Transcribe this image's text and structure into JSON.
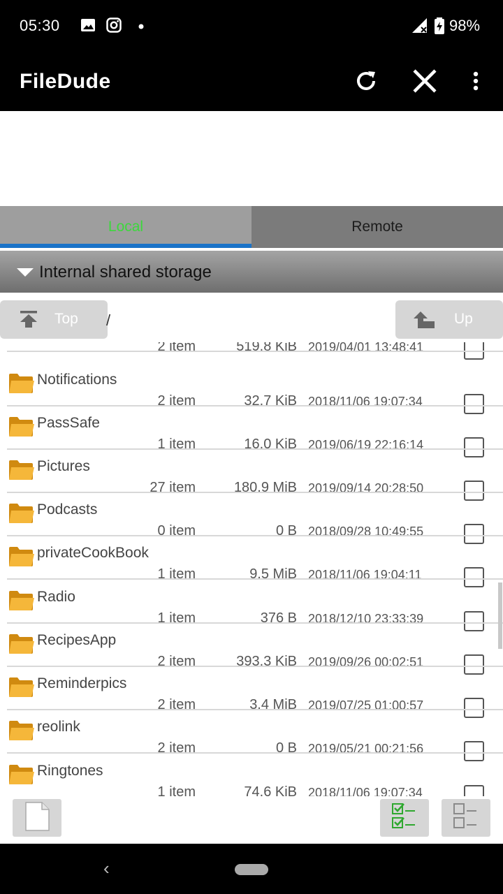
{
  "status_bar": {
    "time": "05:30",
    "battery": "98%",
    "icons": [
      "image-icon",
      "instagram-icon",
      "notification-dot-icon",
      "signal-icon",
      "battery-charging-icon"
    ]
  },
  "app_bar": {
    "title": "FileDude",
    "actions": [
      "refresh-icon",
      "close-icon",
      "more-vert-icon"
    ]
  },
  "tabs": {
    "local": "Local",
    "remote": "Remote",
    "active": "Local"
  },
  "storage": {
    "label": "Internal shared storage"
  },
  "path": {
    "top_label": "Top",
    "up_label": "Up",
    "current": "/"
  },
  "rows": [
    {
      "name": "",
      "count": "2 item",
      "size": "519.8 KiB",
      "date": "2019/04/01 13:48:41"
    },
    {
      "name": "Notifications",
      "count": "2 item",
      "size": "32.7 KiB",
      "date": "2018/11/06 19:07:34"
    },
    {
      "name": "PassSafe",
      "count": "1 item",
      "size": "16.0 KiB",
      "date": "2019/06/19 22:16:14"
    },
    {
      "name": "Pictures",
      "count": "27 item",
      "size": "180.9 MiB",
      "date": "2019/09/14 20:28:50"
    },
    {
      "name": "Podcasts",
      "count": "0 item",
      "size": "0 B",
      "date": "2018/09/28 10:49:55"
    },
    {
      "name": "privateCookBook",
      "count": "1 item",
      "size": "9.5 MiB",
      "date": "2018/11/06 19:04:11"
    },
    {
      "name": "Radio",
      "count": "1 item",
      "size": "376 B",
      "date": "2018/12/10 23:33:39"
    },
    {
      "name": "RecipesApp",
      "count": "2 item",
      "size": "393.3 KiB",
      "date": "2019/09/26 00:02:51"
    },
    {
      "name": "Reminderpics",
      "count": "2 item",
      "size": "3.4 MiB",
      "date": "2019/07/25 01:00:57"
    },
    {
      "name": "reolink",
      "count": "2 item",
      "size": "0 B",
      "date": "2019/05/21 00:21:56"
    },
    {
      "name": "Ringtones",
      "count": "1 item",
      "size": "74.6 KiB",
      "date": "2018/11/06 19:07:34"
    }
  ],
  "bottom_bar": {
    "icons": [
      "new-file-icon",
      "select-all-icon",
      "deselect-all-icon"
    ]
  },
  "colors": {
    "local_tab_text": "#3cd83c",
    "tab_underline": "#1a73c8",
    "folder": "#f0b030",
    "select_all_icon": "#2fa82f"
  }
}
